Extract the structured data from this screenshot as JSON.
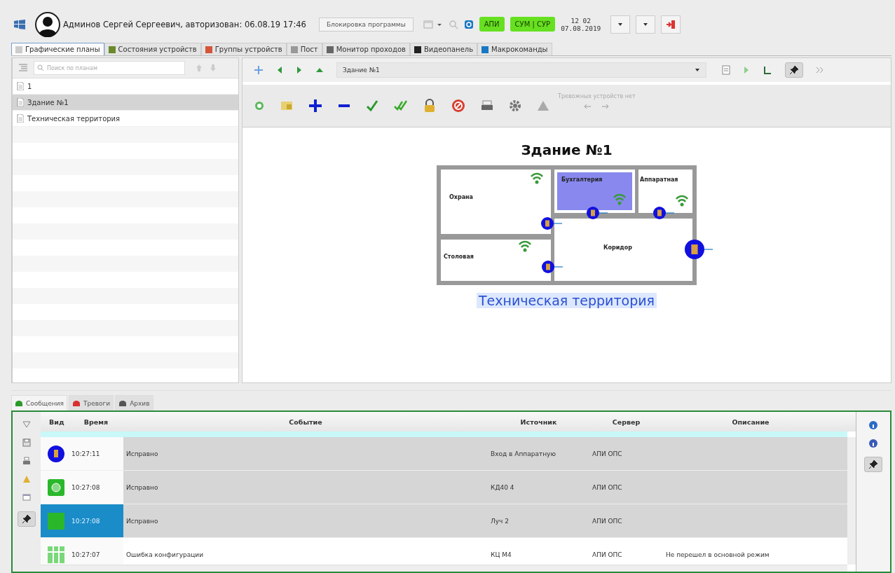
{
  "top_bar": {
    "user": "Админов Сергей Сергеевич, авторизован: 06.08.19 17:46",
    "lock_button": "Блокировка программы",
    "badges": [
      "АПИ",
      "СУМ | СУР"
    ],
    "time": "12 02",
    "date": "07.08.2019"
  },
  "tabs": [
    {
      "label": "Графические планы",
      "selected": true
    },
    {
      "label": "Состояния устройств",
      "selected": false
    },
    {
      "label": "Группы устройств",
      "selected": false
    },
    {
      "label": "Пост",
      "selected": false
    },
    {
      "label": "Монитор проходов",
      "selected": false
    },
    {
      "label": "Видеопанель",
      "selected": false
    },
    {
      "label": "Макрокоманды",
      "selected": false
    }
  ],
  "plans": {
    "search": {
      "placeholder": "Поиск по планам"
    },
    "items": [
      {
        "label": "1",
        "selected": false
      },
      {
        "label": "Здание №1",
        "selected": true
      },
      {
        "label": "Техническая территория",
        "selected": false
      }
    ]
  },
  "plan_view": {
    "current_plan": "Здание №1",
    "pin_pressed": true,
    "alarm_status": "Тревожных устройств нет",
    "title": "Здание №1",
    "rooms": [
      {
        "label": "Охрана",
        "selected": false
      },
      {
        "label": "Бухгалтерия",
        "selected": true
      },
      {
        "label": "Аппаратная",
        "selected": false
      },
      {
        "label": "Столовая",
        "selected": false
      },
      {
        "label": "Коридор",
        "selected": false
      }
    ],
    "link": "Техническая территория"
  },
  "log": {
    "tabs": [
      {
        "label": "Сообщения",
        "selected": true
      },
      {
        "label": "Тревоги",
        "selected": false
      },
      {
        "label": "Архив",
        "selected": false
      }
    ],
    "left_pin_pressed": true,
    "right_pin_pressed": true,
    "columns": [
      "Вид",
      "Время",
      "Событие",
      "Источник",
      "Сервер",
      "Описание"
    ],
    "rows": [
      {
        "kind": "door",
        "time": "10:27:11",
        "event": "Исправно",
        "source": "Вход в Аппаратную",
        "server": "АПИ ОПС",
        "description": "",
        "highlighted": true,
        "selected": false
      },
      {
        "kind": "module",
        "time": "10:27:08",
        "event": "Исправно",
        "source": "КД40 4",
        "server": "АПИ ОПС",
        "description": "",
        "highlighted": true,
        "selected": false
      },
      {
        "kind": "zone",
        "time": "10:27:08",
        "event": "Исправно",
        "source": "Луч 2",
        "server": "АПИ ОПС",
        "description": "",
        "highlighted": true,
        "selected": true
      },
      {
        "kind": "config",
        "time": "10:27:07",
        "event": "Ошибка конфигурации",
        "source": "КЦ М4",
        "server": "АПИ ОПС",
        "description": "Не перешел в основной режим",
        "highlighted": false,
        "selected": false
      }
    ]
  }
}
